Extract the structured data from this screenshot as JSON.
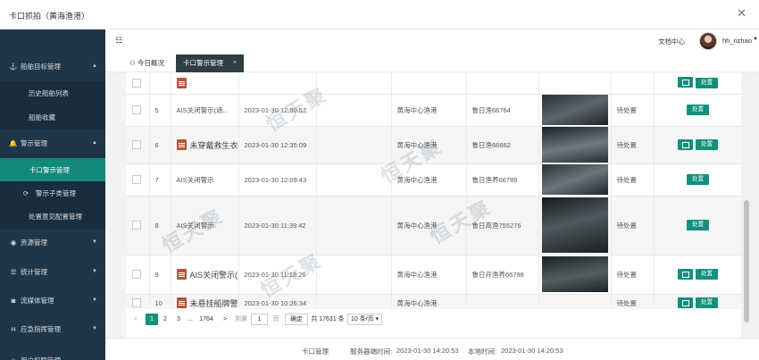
{
  "window": {
    "title": "卡口抓拍（黄海渔港）"
  },
  "header": {
    "doc_center": "文档中心",
    "username": "hh_rizhao"
  },
  "sidebar": {
    "items": [
      {
        "label": "船舶目标管理",
        "icon": "anchor-icon",
        "arrow": "▲"
      },
      {
        "label": "历史船舶列表"
      },
      {
        "label": "船舶收藏"
      },
      {
        "label": "警示管理",
        "icon": "bell-icon",
        "arrow": "▲"
      },
      {
        "label": "卡口警示管理"
      },
      {
        "label": "警示子类管理"
      },
      {
        "label": "处置意见配置管理"
      },
      {
        "label": "资源管理",
        "icon": "cube-icon",
        "arrow": "▼"
      },
      {
        "label": "统计管理",
        "icon": "chart-icon",
        "arrow": "▼"
      },
      {
        "label": "流媒体管理",
        "icon": "camera-icon",
        "arrow": "▼"
      },
      {
        "label": "应急指挥管理",
        "icon": "h-icon",
        "arrow": "▼"
      },
      {
        "label": "用户权限管理"
      }
    ]
  },
  "tabs": {
    "home": "今日概况",
    "active": "卡口警示管理",
    "close": "×"
  },
  "rows": [
    {
      "no": "5",
      "type": "AIS关闭警示(遮...",
      "time": "2023-01-30 12:50:57",
      "port": "黄海中心渔港",
      "ship": "鲁日渔66764",
      "status": "待处置",
      "btn": "处置"
    },
    {
      "no": "6",
      "type": "未穿戴救生衣警",
      "time": "2023-01-30 12:35:09",
      "port": "黄海中心渔港",
      "ship": "鲁日渔66662",
      "status": "待处置",
      "btn": "处置"
    },
    {
      "no": "7",
      "type": "AIS关闭警示",
      "time": "2023-01-30 12:09:43",
      "port": "黄海中心渔港",
      "ship": "鲁日渔养66789",
      "status": "待处置",
      "btn": "处置"
    },
    {
      "no": "8",
      "type": "AIS关闭警示",
      "time": "2023-01-30 11:39:42",
      "port": "黄海中心渔港",
      "ship": "鲁日高渔755276",
      "status": "待处置",
      "btn": "处置"
    },
    {
      "no": "9",
      "type": "AIS关闭警示(未",
      "time": "2023-01-30 11:18:26",
      "port": "黄海中心渔港",
      "ship": "鲁日开渔养66798",
      "status": "待处置",
      "btn": "处置"
    },
    {
      "no": "10",
      "type": "未悬挂船牌警示",
      "time": "2023-01-30 10:26:34",
      "port": "黄海中心渔港",
      "ship": "",
      "status": "待处置",
      "btn": "处置"
    }
  ],
  "pager": {
    "prev": "<",
    "p1": "1",
    "p2": "2",
    "p3": "3",
    "ellipsis": "...",
    "last": "1764",
    "next": ">",
    "goto": "到第",
    "page_value": "1",
    "page_unit": "页",
    "confirm": "确定",
    "total": "共 17631 条",
    "size": "10 条/页 ▾"
  },
  "footer": {
    "module": "卡口管理",
    "server_time_label": "服务器端时间:",
    "server_time": "2023-01-30 14:20:53",
    "local_time_label": "本地时间:",
    "local_time": "2023-01-30 14:20:53"
  },
  "watermark": "恒天聚",
  "colors": {
    "sidebar": "#1f3648",
    "accent": "#12907c",
    "active_tab": "#2f3d47"
  }
}
